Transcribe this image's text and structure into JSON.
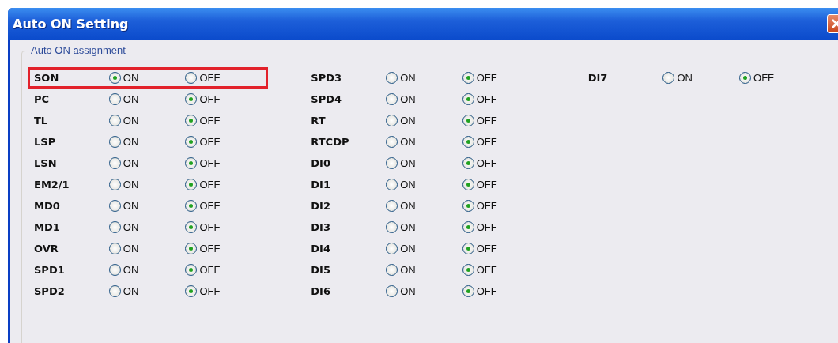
{
  "window": {
    "title": "Auto ON Setting"
  },
  "group": {
    "title": "Auto ON assignment"
  },
  "columns": [
    [
      {
        "name": "SON",
        "highlighted": true,
        "options": [
          {
            "label": "ON",
            "selected": true
          },
          {
            "label": "OFF",
            "selected": false
          }
        ]
      },
      {
        "name": "PC",
        "highlighted": false,
        "options": [
          {
            "label": "ON",
            "selected": false
          },
          {
            "label": "OFF",
            "selected": true
          }
        ]
      },
      {
        "name": "TL",
        "highlighted": false,
        "options": [
          {
            "label": "ON",
            "selected": false
          },
          {
            "label": "OFF",
            "selected": true
          }
        ]
      },
      {
        "name": "LSP",
        "highlighted": false,
        "options": [
          {
            "label": "ON",
            "selected": false
          },
          {
            "label": "OFF",
            "selected": true
          }
        ]
      },
      {
        "name": "LSN",
        "highlighted": false,
        "options": [
          {
            "label": "ON",
            "selected": false
          },
          {
            "label": "OFF",
            "selected": true
          }
        ]
      },
      {
        "name": "EM2/1",
        "highlighted": false,
        "options": [
          {
            "label": "ON",
            "selected": false
          },
          {
            "label": "OFF",
            "selected": true
          }
        ]
      },
      {
        "name": "MD0",
        "highlighted": false,
        "options": [
          {
            "label": "ON",
            "selected": false
          },
          {
            "label": "OFF",
            "selected": true
          }
        ]
      },
      {
        "name": "MD1",
        "highlighted": false,
        "options": [
          {
            "label": "ON",
            "selected": false
          },
          {
            "label": "OFF",
            "selected": true
          }
        ]
      },
      {
        "name": "OVR",
        "highlighted": false,
        "options": [
          {
            "label": "ON",
            "selected": false
          },
          {
            "label": "OFF",
            "selected": true
          }
        ]
      },
      {
        "name": "SPD1",
        "highlighted": false,
        "options": [
          {
            "label": "ON",
            "selected": false
          },
          {
            "label": "OFF",
            "selected": true
          }
        ]
      },
      {
        "name": "SPD2",
        "highlighted": false,
        "options": [
          {
            "label": "ON",
            "selected": false
          },
          {
            "label": "OFF",
            "selected": true
          }
        ]
      }
    ],
    [
      {
        "name": "SPD3",
        "highlighted": false,
        "options": [
          {
            "label": "ON",
            "selected": false
          },
          {
            "label": "OFF",
            "selected": true
          }
        ]
      },
      {
        "name": "SPD4",
        "highlighted": false,
        "options": [
          {
            "label": "ON",
            "selected": false
          },
          {
            "label": "OFF",
            "selected": true
          }
        ]
      },
      {
        "name": "RT",
        "highlighted": false,
        "options": [
          {
            "label": "ON",
            "selected": false
          },
          {
            "label": "OFF",
            "selected": true
          }
        ]
      },
      {
        "name": "RTCDP",
        "highlighted": false,
        "options": [
          {
            "label": "ON",
            "selected": false
          },
          {
            "label": "OFF",
            "selected": true
          }
        ]
      },
      {
        "name": "DI0",
        "highlighted": false,
        "options": [
          {
            "label": "ON",
            "selected": false
          },
          {
            "label": "OFF",
            "selected": true
          }
        ]
      },
      {
        "name": "DI1",
        "highlighted": false,
        "options": [
          {
            "label": "ON",
            "selected": false
          },
          {
            "label": "OFF",
            "selected": true
          }
        ]
      },
      {
        "name": "DI2",
        "highlighted": false,
        "options": [
          {
            "label": "ON",
            "selected": false
          },
          {
            "label": "OFF",
            "selected": true
          }
        ]
      },
      {
        "name": "DI3",
        "highlighted": false,
        "options": [
          {
            "label": "ON",
            "selected": false
          },
          {
            "label": "OFF",
            "selected": true
          }
        ]
      },
      {
        "name": "DI4",
        "highlighted": false,
        "options": [
          {
            "label": "ON",
            "selected": false
          },
          {
            "label": "OFF",
            "selected": true
          }
        ]
      },
      {
        "name": "DI5",
        "highlighted": false,
        "options": [
          {
            "label": "ON",
            "selected": false
          },
          {
            "label": "OFF",
            "selected": true
          }
        ]
      },
      {
        "name": "DI6",
        "highlighted": false,
        "options": [
          {
            "label": "ON",
            "selected": false
          },
          {
            "label": "OFF",
            "selected": true
          }
        ]
      }
    ],
    [
      {
        "name": "DI7",
        "highlighted": false,
        "options": [
          {
            "label": "ON",
            "selected": false
          },
          {
            "label": "OFF",
            "selected": true
          }
        ]
      }
    ]
  ]
}
